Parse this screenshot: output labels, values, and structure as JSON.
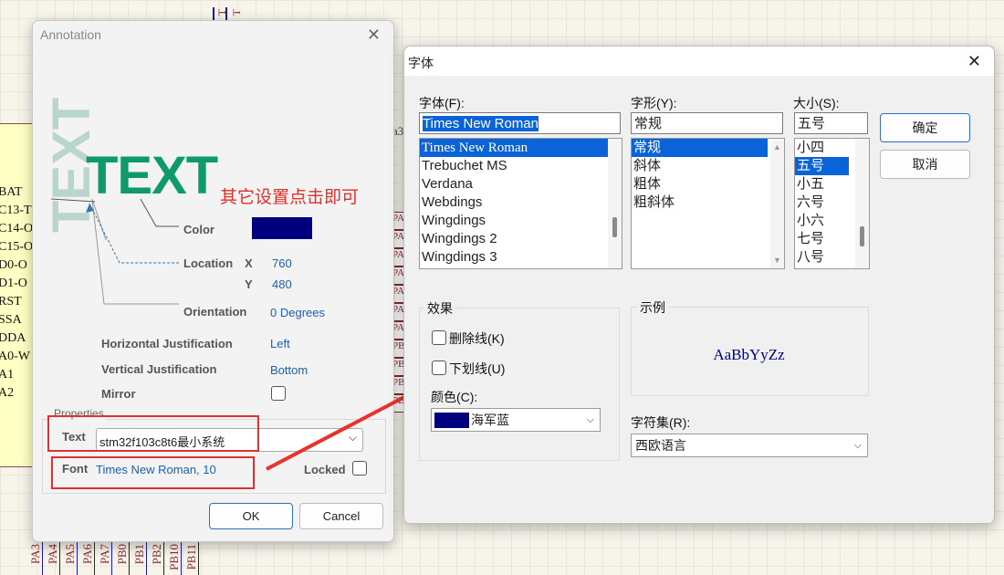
{
  "background": {
    "pin_labels": [
      "BAT",
      "C13-T",
      "C14-O",
      "C15-O",
      "D0-O",
      "D1-O",
      "RST",
      "SSA",
      "DDA",
      "A0-W",
      "A1",
      "A2"
    ],
    "pa_boxes": [
      "PA",
      "PA",
      "PA",
      "PA",
      "PA",
      "PA",
      "PA",
      "PB",
      "PB",
      "PB",
      "PB"
    ],
    "bottom_pins": [
      "PA3",
      "PA4",
      "PA5",
      "PA6",
      "PA7",
      "PB0",
      "PB1",
      "PB2",
      "PB10",
      "PB11"
    ],
    "side_text": "a3",
    "colors": {
      "chip_fill": "#ffffc4",
      "wire": "#1a1ab0",
      "pin_text": "#8a2a2a"
    }
  },
  "annotation_dialog": {
    "title": "Annotation",
    "preview_vertical_text": "TEXT",
    "preview_text": "TEXT",
    "callout": "其它设置点击即可",
    "color_label": "Color",
    "color_value": "#00007f",
    "location_label": "Location",
    "x_label": "X",
    "x_value": "760",
    "y_label": "Y",
    "y_value": "480",
    "orientation_label": "Orientation",
    "orientation_value": "0 Degrees",
    "h_just_label": "Horizontal Justification",
    "h_just_value": "Left",
    "v_just_label": "Vertical Justification",
    "v_just_value": "Bottom",
    "mirror_label": "Mirror",
    "properties_label": "Properties",
    "text_label": "Text",
    "text_value": "stm32f103c8t6最小系统",
    "font_label": "Font",
    "font_value": "Times New Roman, 10",
    "locked_label": "Locked",
    "ok_label": "OK",
    "cancel_label": "Cancel",
    "accent_green": "#0e9a6a"
  },
  "font_dialog": {
    "title": "字体",
    "font_label": "字体(F):",
    "font_value": "Times New Roman",
    "fonts": [
      "Times New Roman",
      "Trebuchet MS",
      "Verdana",
      "Webdings",
      "Wingdings",
      "Wingdings 2",
      "Wingdings 3"
    ],
    "style_label": "字形(Y):",
    "style_value": "常规",
    "styles": [
      "常规",
      "斜体",
      "粗体",
      "粗斜体"
    ],
    "size_label": "大小(S):",
    "size_value": "五号",
    "sizes": [
      "小四",
      "五号",
      "小五",
      "六号",
      "小六",
      "七号",
      "八号"
    ],
    "ok_label": "确定",
    "cancel_label": "取消",
    "effects_label": "效果",
    "strikeout_label": "删除线(K)",
    "underline_label": "下划线(U)",
    "color_label": "颜色(C):",
    "color_value": "海军蓝",
    "color_swatch": "#00007f",
    "sample_label": "示例",
    "sample_text": "AaBbYyZz",
    "charset_label": "字符集(R):",
    "charset_value": "西欧语言"
  }
}
